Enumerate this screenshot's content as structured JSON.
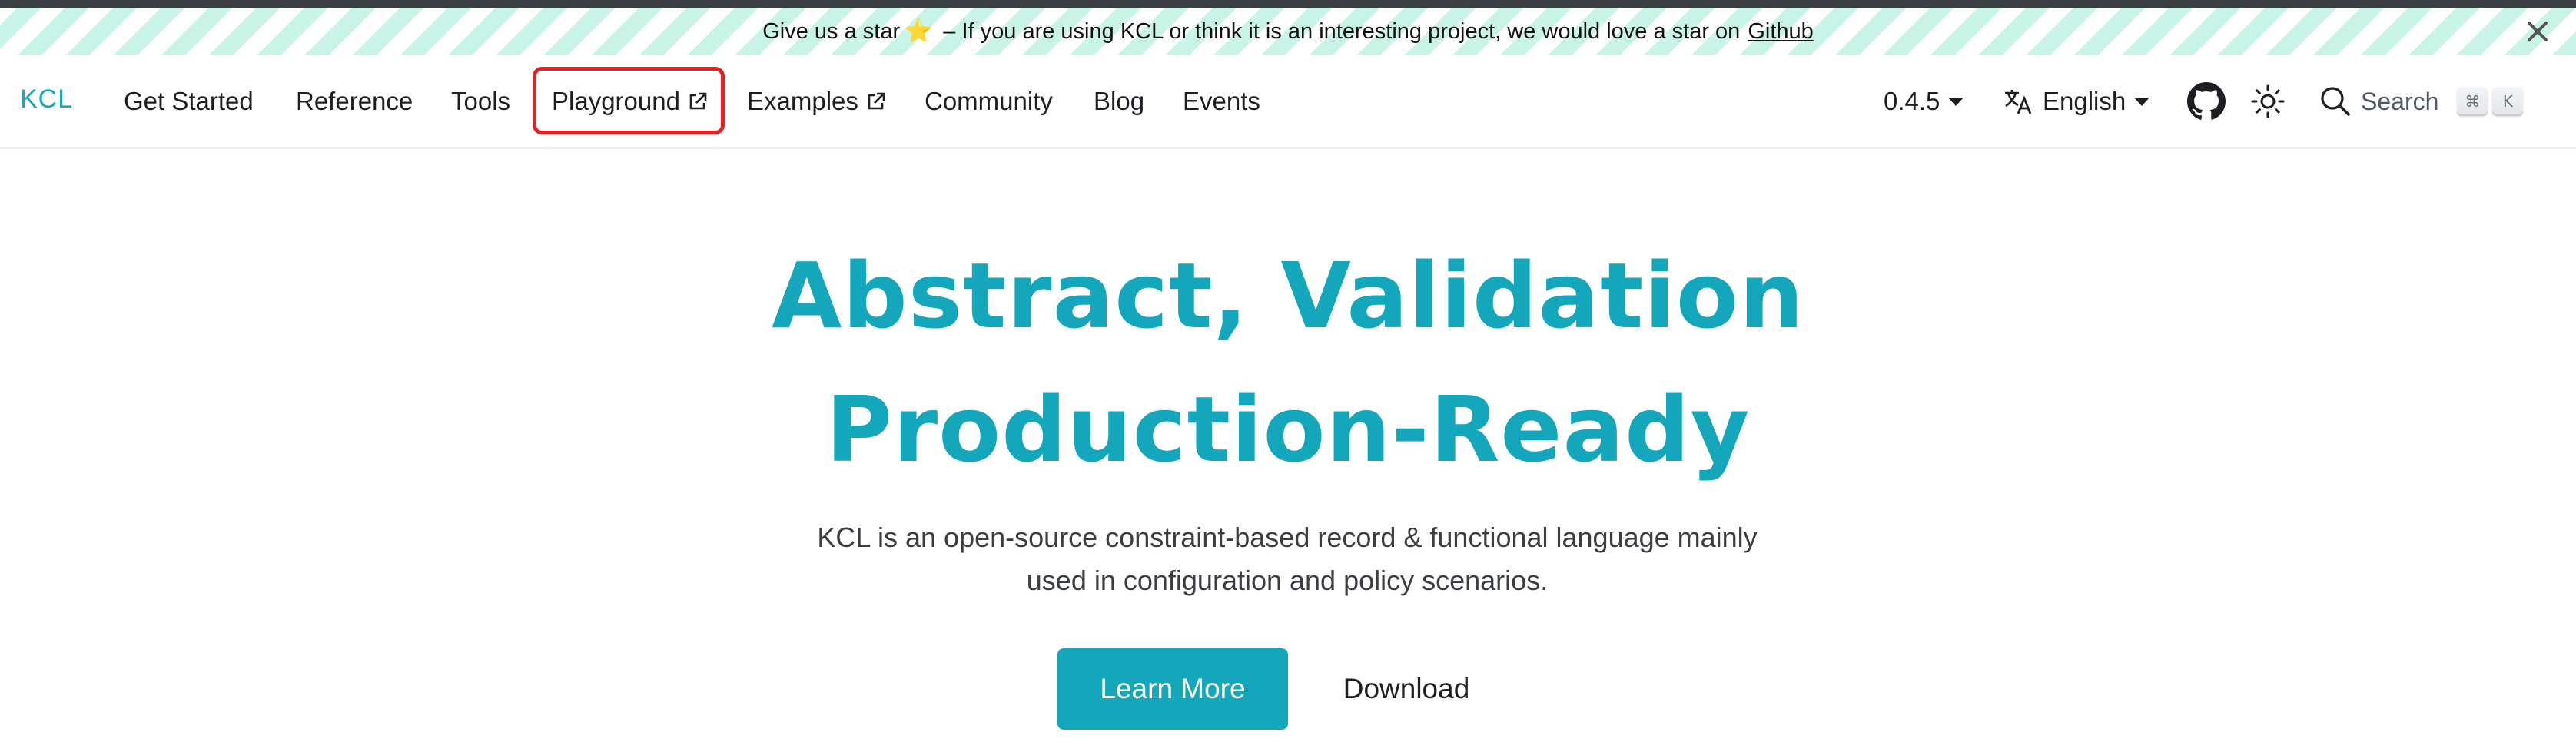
{
  "announcement": {
    "text_before": "Give us a star",
    "star": "⭐",
    "text_after": " – If you are using KCL or think it is an interesting project, we would love a star on",
    "link": "Github"
  },
  "navbar": {
    "logo": "KCL",
    "items": [
      {
        "label": "Get Started"
      },
      {
        "label": "Reference"
      },
      {
        "label": "Tools"
      },
      {
        "label": "Playground",
        "external": true
      },
      {
        "label": "Examples",
        "external": true
      },
      {
        "label": "Community"
      },
      {
        "label": "Blog"
      },
      {
        "label": "Events"
      }
    ],
    "version": "0.4.5",
    "language": "English",
    "search": {
      "label": "Search",
      "key1": "⌘",
      "key2": "K"
    }
  },
  "hero": {
    "title_line1": "Abstract, Validation",
    "title_line2": "Production-Ready",
    "subtitle_line1": "KCL is an open-source constraint-based record & functional language mainly",
    "subtitle_line2": "used in configuration and policy scenarios.",
    "primary_button": "Learn More",
    "secondary_button": "Download"
  },
  "colors": {
    "brand": "#14a6bb",
    "highlight": "#e02424",
    "announcement_stripe": "#c8f3e6"
  },
  "icons": [
    "external-link-icon",
    "caret-down-icon",
    "translate-icon",
    "github-icon",
    "sun-icon",
    "search-icon",
    "close-icon"
  ]
}
